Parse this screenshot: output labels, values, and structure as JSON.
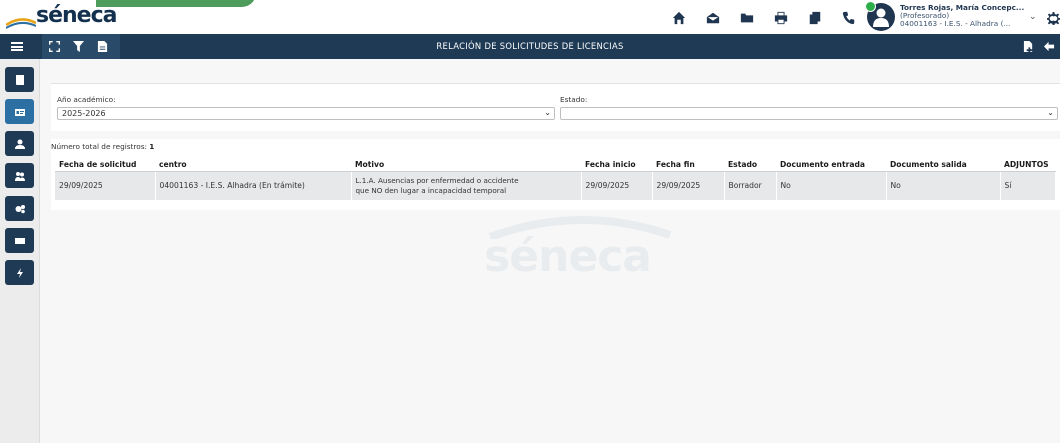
{
  "app": {
    "logo_text": "séneca",
    "page_title": "RELACIÓN DE SOLICITUDES DE LICENCIAS",
    "watermark_text": "séneca"
  },
  "user": {
    "name": "Torres Rojas, María Concepc...",
    "role": "(Profesorado)",
    "centro": "04001163 - I.E.S. - Alhadra (...",
    "chevron": "⌄"
  },
  "top_icons": [
    "home-icon",
    "mail-icon",
    "folder-icon",
    "print-icon",
    "copy-icon",
    "phone-icon"
  ],
  "toolbar_icons": [
    "fullscreen-icon",
    "filter-icon",
    "export-pdf-icon"
  ],
  "toolbar_right_icons": [
    "new-document-icon",
    "back-arrow-icon"
  ],
  "sidebar_icons": [
    "book-icon",
    "id-card-icon",
    "user-icon",
    "users-icon",
    "cogs-icon",
    "envelope-icon",
    "bolt-icon"
  ],
  "filters": {
    "academic_year_label": "Año académico:",
    "academic_year_value": "2025-2026",
    "status_label": "Estado:",
    "status_value": ""
  },
  "records": {
    "total_label": "Número total de registros:",
    "total_value": "1"
  },
  "table": {
    "columns": [
      "Fecha de solicitud",
      "centro",
      "Motivo",
      "Fecha inicio",
      "Fecha fin",
      "Estado",
      "Documento entrada",
      "Documento salida",
      "ADJUNTOS"
    ],
    "rows": [
      {
        "fecha_solicitud": "29/09/2025",
        "centro": "04001163 - I.E.S. Alhadra (En trámite)",
        "motivo_line1": "L.1.A. Ausencias por enfermedad o accidente",
        "motivo_line2": "que NO den lugar a incapacidad temporal",
        "fecha_inicio": "29/09/2025",
        "fecha_fin": "29/09/2025",
        "estado": "Borrador",
        "doc_entrada": "No",
        "doc_salida": "No",
        "adjuntos": "Sí"
      }
    ]
  },
  "colors": {
    "navbar": "#1e3a55",
    "sidebar_active": "#2b6fa3",
    "logo": "#13314f",
    "accent_green": "#2e8b3f"
  }
}
